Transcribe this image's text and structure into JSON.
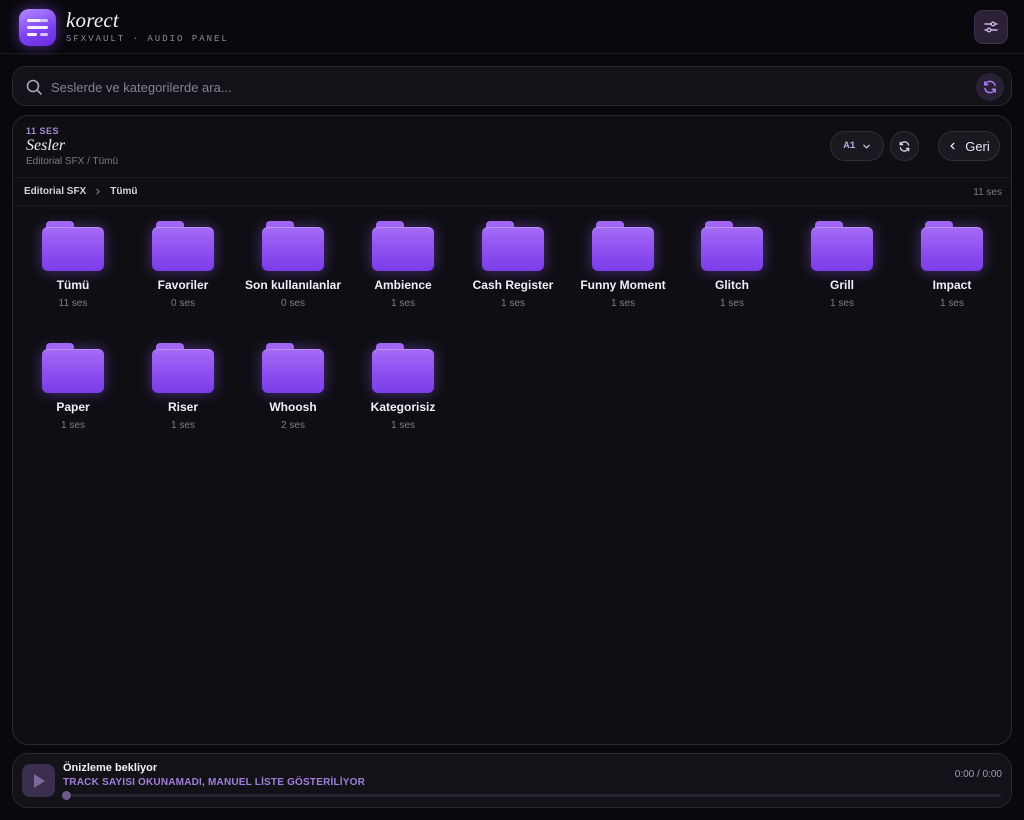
{
  "app": {
    "name": "korect",
    "subtitle": "SFXVAULT · AUDIO PANEL"
  },
  "search": {
    "placeholder": "Seslerde ve kategorilerde ara..."
  },
  "panel": {
    "count_label": "11 SES",
    "title": "Sesler",
    "path": "Editorial SFX / Tümü",
    "channel_select": "A1",
    "back_label": "Geri"
  },
  "breadcrumb": {
    "items": [
      "Editorial SFX",
      "Tümü"
    ],
    "count": "11 ses"
  },
  "folders": [
    {
      "name": "Tümü",
      "count": "11 ses"
    },
    {
      "name": "Favoriler",
      "count": "0 ses"
    },
    {
      "name": "Son kullanılanlar",
      "count": "0 ses"
    },
    {
      "name": "Ambience",
      "count": "1 ses"
    },
    {
      "name": "Cash Register",
      "count": "1 ses"
    },
    {
      "name": "Funny Moment",
      "count": "1 ses"
    },
    {
      "name": "Glitch",
      "count": "1 ses"
    },
    {
      "name": "Grill",
      "count": "1 ses"
    },
    {
      "name": "Impact",
      "count": "1 ses"
    },
    {
      "name": "Paper",
      "count": "1 ses"
    },
    {
      "name": "Riser",
      "count": "1 ses"
    },
    {
      "name": "Whoosh",
      "count": "2 ses"
    },
    {
      "name": "Kategorisiz",
      "count": "1 ses"
    }
  ],
  "player": {
    "title": "Önizleme bekliyor",
    "status": "TRACK SAYISI OKUNAMADI, MANUEL LİSTE GÖSTERİLİYOR",
    "time": "0:00 / 0:00",
    "progress": 0
  },
  "colors": {
    "accent": "#8d4ef0",
    "background": "#09080c",
    "status_text": "#a07fd8"
  }
}
